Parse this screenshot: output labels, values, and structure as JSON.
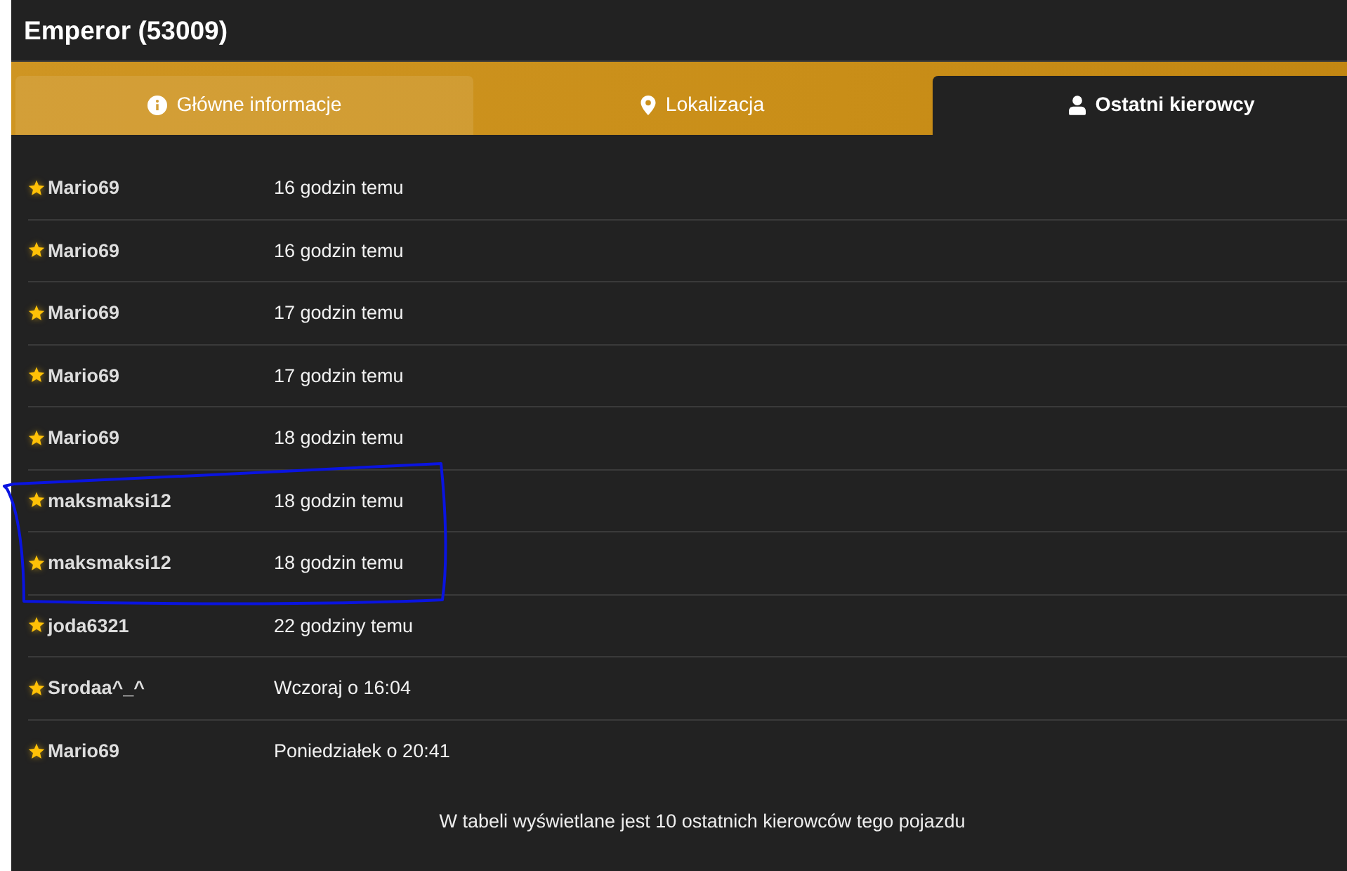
{
  "window": {
    "title": "Emperor (53009)"
  },
  "tabs": [
    {
      "label": "Główne informacje",
      "selected": false,
      "highlighted": true
    },
    {
      "label": "Lokalizacja",
      "selected": false,
      "highlighted": false
    },
    {
      "label": "Ostatni kierowcy",
      "selected": true,
      "highlighted": false
    }
  ],
  "table": {
    "rows": [
      [
        "Mario69",
        "16 godzin temu"
      ],
      [
        "Mario69",
        "16 godzin temu"
      ],
      [
        "Mario69",
        "17 godzin temu"
      ],
      [
        "Mario69",
        "17 godzin temu"
      ],
      [
        "Mario69",
        "18 godzin temu"
      ],
      [
        "maksmaksi12",
        "18 godzin temu"
      ],
      [
        "maksmaksi12",
        "18 godzin temu"
      ],
      [
        "joda6321",
        "22 godziny temu"
      ],
      [
        "Srodaa^_^",
        "Wczoraj o 16:04"
      ],
      [
        "Mario69",
        "Poniedziałek o 20:41"
      ]
    ]
  },
  "footer": {
    "note": "W tabeli wyświetlane jest 10 ostatnich kierowców tego pojazdu"
  }
}
